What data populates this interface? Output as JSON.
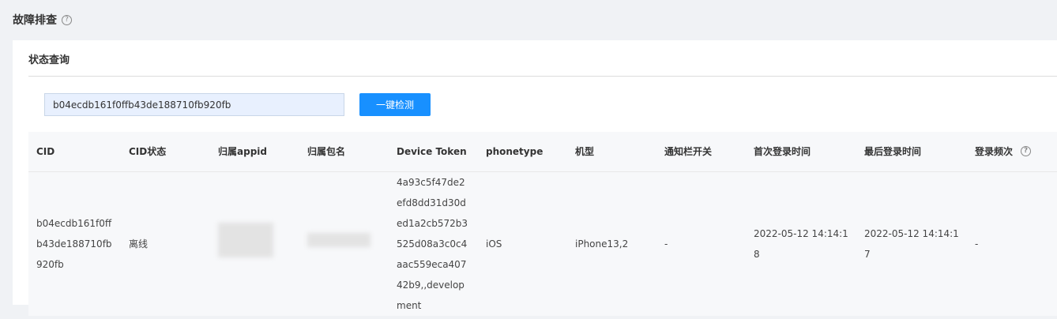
{
  "page": {
    "title": "故障排查",
    "help_icon": "question-circle-icon"
  },
  "card": {
    "title": "状态查询"
  },
  "search": {
    "value": "b04ecdb161f0ffb43de188710fb920fb",
    "button_label": "一键检测"
  },
  "table": {
    "columns": [
      "CID",
      "CID状态",
      "归属appid",
      "归属包名",
      "Device Token",
      "phonetype",
      "机型",
      "通知栏开关",
      "首次登录时间",
      "最后登录时间",
      "登录频次"
    ],
    "rows": [
      {
        "cid": "b04ecdb161f0ffb43de188710fb920fb",
        "status": "离线",
        "device_token": "4a93c5f47de2efd8dd31d30ded1a2cb572b3525d08a3c0c4aac559eca40742b9,,development",
        "phonetype": "iOS",
        "model": "iPhone13,2",
        "notification": "-",
        "first_login": "2022-05-12 14:14:18",
        "last_login": "2022-05-12 14:14:17",
        "frequency": "-"
      }
    ]
  },
  "colors": {
    "primary": "#1890ff",
    "background": "#f0f2f5",
    "input_bg": "#e8f0fe"
  }
}
